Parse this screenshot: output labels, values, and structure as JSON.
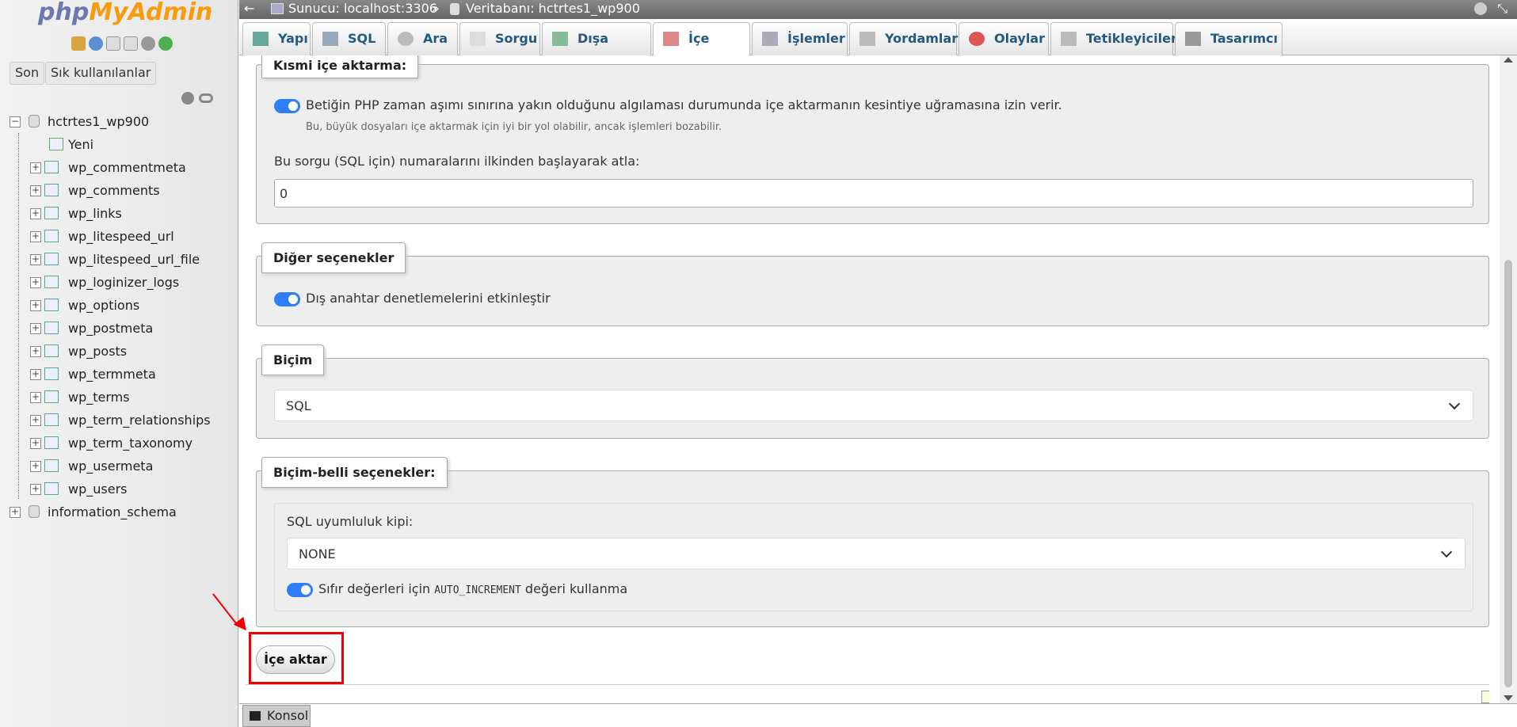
{
  "app": {
    "logo_php": "php",
    "logo_my": "MyAdmin",
    "logo_admin": "Admin"
  },
  "sidebar": {
    "recent_label": "Son",
    "favorites_label": "Sık kullanılanlar",
    "db_name": "hctrtes1_wp900",
    "new_label": "Yeni",
    "tables": [
      "wp_commentmeta",
      "wp_comments",
      "wp_links",
      "wp_litespeed_url",
      "wp_litespeed_url_file",
      "wp_loginizer_logs",
      "wp_options",
      "wp_postmeta",
      "wp_posts",
      "wp_termmeta",
      "wp_terms",
      "wp_term_relationships",
      "wp_term_taxonomy",
      "wp_usermeta",
      "wp_users"
    ],
    "other_db": "information_schema"
  },
  "breadcrumb": {
    "server": "Sunucu: localhost:3306",
    "separator": "»",
    "database": "Veritabanı: hctrtes1_wp900"
  },
  "tabs": [
    "Yapı",
    "SQL",
    "Ara",
    "Sorgu",
    "Dışa aktar",
    "İçe aktar",
    "İşlemler",
    "Yordamlar",
    "Olaylar",
    "Tetikleyiciler",
    "Tasarımcı"
  ],
  "partial_import": {
    "legend": "Kısmi içe aktarma:",
    "interrupt_label": "Betiğin PHP zaman aşımı sınırına yakın olduğunu algılaması durumunda içe aktarmanın kesintiye uğramasına izin verir.",
    "interrupt_hint": "Bu, büyük dosyaları içe aktarmak için iyi bir yol olabilir, ancak işlemleri bozabilir.",
    "skip_label": "Bu sorgu (SQL için) numaralarını ilkinden başlayarak atla:",
    "skip_value": "0"
  },
  "other_options": {
    "legend": "Diğer seçenekler",
    "fk_label": "Dış anahtar denetlemelerini etkinleştir"
  },
  "format": {
    "legend": "Biçim",
    "selected": "SQL"
  },
  "format_options": {
    "legend": "Biçim-belli seçenekler:",
    "compat_label": "SQL uyumluluk kipi:",
    "compat_selected": "NONE",
    "ai_prefix": "Sıfır değerleri için",
    "ai_code": "AUTO_INCREMENT",
    "ai_suffix": "değeri kullanma"
  },
  "submit_label": "İçe aktar",
  "console_label": "Konsol",
  "colors": {
    "accent": "#2f7ef7",
    "tab_text": "#235a81",
    "highlight": "#e00000"
  }
}
